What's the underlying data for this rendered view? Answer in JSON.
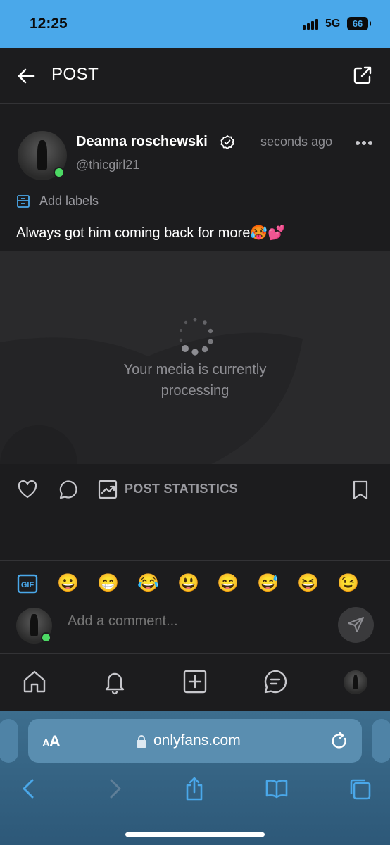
{
  "status_bar": {
    "time": "12:25",
    "network": "5G",
    "battery": "66"
  },
  "header": {
    "title": "POST",
    "back_icon": "back-arrow-icon",
    "share_icon": "share-icon"
  },
  "post": {
    "author_name": "Deanna roschewski",
    "handle": "@thicgirl21",
    "timestamp": "seconds ago",
    "add_labels": "Add labels",
    "text": "Always got him coming back for more🥵💕",
    "media_status_line1": "Your media is currently",
    "media_status_line2": "processing",
    "post_statistics": "POST STATISTICS"
  },
  "comment_box": {
    "emojis": [
      "😀",
      "😁",
      "😂",
      "😃",
      "😄",
      "😅",
      "😆",
      "😉"
    ],
    "placeholder": "Add a comment..."
  },
  "browser": {
    "aa_large": "A",
    "aa_small": "A",
    "url": "onlyfans.com"
  },
  "colors": {
    "status_bar": "#4aa8ea",
    "background": "#1c1c1e",
    "accent": "#4aa8ea",
    "online": "#4cd964",
    "muted_text": "#8e8e93"
  }
}
